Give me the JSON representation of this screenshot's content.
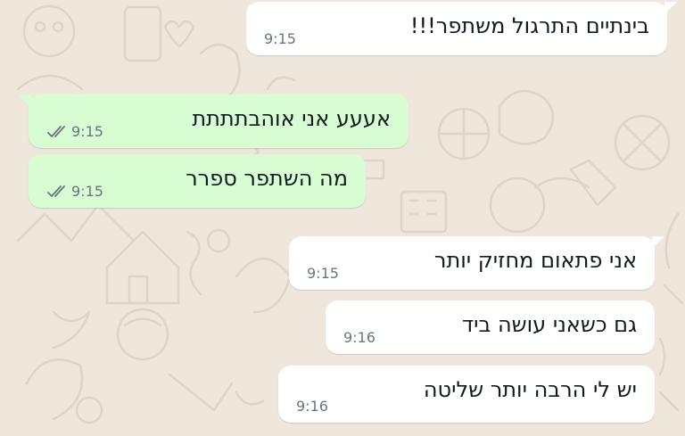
{
  "colors": {
    "incoming_bubble": "#ffffff",
    "outgoing_bubble": "#d9fdd3",
    "wallpaper": "#efe7dc",
    "time_text": "#667781",
    "tick_color": "#667781"
  },
  "messages": [
    {
      "direction": "incoming",
      "text": "בינתיים התרגול משתפר!!!",
      "time": "9:15"
    },
    {
      "direction": "outgoing",
      "text": "אעעע אני אוהבתתתת",
      "time": "9:15",
      "status_icon": "double-check-icon"
    },
    {
      "direction": "outgoing",
      "text": "מה השתפר ספרר",
      "time": "9:15",
      "status_icon": "double-check-icon"
    },
    {
      "direction": "incoming",
      "text": "אני פתאום מחזיק יותר",
      "time": "9:15"
    },
    {
      "direction": "incoming",
      "text": "גם כשאני עושה ביד",
      "time": "9:16"
    },
    {
      "direction": "incoming",
      "text": "יש לי הרבה יותר שליטה",
      "time": "9:16"
    }
  ]
}
